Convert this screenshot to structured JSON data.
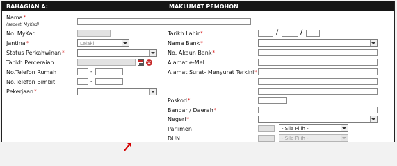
{
  "header": {
    "section": "BAHAGIAN A:",
    "title": "MAKLUMAT PEMOHON"
  },
  "required_mark": "*",
  "left": {
    "nama": {
      "label": "Nama",
      "hint": "(seperti MyKad)"
    },
    "mykad": {
      "label": "No. MyKad"
    },
    "jantina": {
      "label": "Jantina",
      "value": "Lelaki"
    },
    "status": {
      "label": "Status Perkahwinan",
      "value": ""
    },
    "tarikh_cerai": {
      "label": "Tarikh Perceraian"
    },
    "tel_rumah": {
      "label": "No.Telefon Rumah",
      "sep": "-"
    },
    "tel_bimbit": {
      "label": "No.Telefon Bimbit",
      "sep": "-"
    },
    "pekerjaan": {
      "label": "Pekerjaan",
      "value": ""
    }
  },
  "right": {
    "tarikh_lahir": {
      "label": "Tarikh Lahir",
      "sep": "/"
    },
    "bank": {
      "label": "Nama Bank",
      "value": ""
    },
    "akaun": {
      "label": "No. Akaun Bank"
    },
    "emel": {
      "label": "Alamat e-Mel"
    },
    "alamat": {
      "label": "Alamat Surat- Menyurat Terkini"
    },
    "poskod": {
      "label": "Poskod"
    },
    "bandar": {
      "label": "Bandar / Daerah"
    },
    "negeri": {
      "label": "Negeri",
      "value": ""
    },
    "parlimen": {
      "label": "Parlimen",
      "value": "- Sila Pilih -"
    },
    "dun": {
      "label": "DUN",
      "value": "- Sila Pilih -"
    }
  },
  "colors": {
    "header_bg": "#161616",
    "required": "#d40000",
    "cursor": "#d40000"
  },
  "icons": {
    "calendar": "calendar-icon",
    "clear": "clear-date-icon",
    "cursor": "mouse-cursor-icon"
  }
}
